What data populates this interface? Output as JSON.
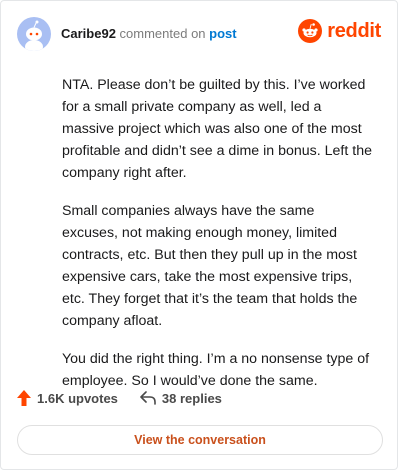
{
  "header": {
    "username": "Caribe92",
    "action_text": "commented on",
    "post_link": "post",
    "brand_name": "reddit"
  },
  "comment": {
    "paragraphs": [
      "NTA. Please don’t be guilted by this. I’ve worked for a small private company as well, led a massive project which was also one of the most profitable and didn’t see a dime in bonus. Left the company right after.",
      "Small companies always have the same excuses, not making enough money, limited contracts, etc. But then they pull up in the most expensive cars, take the most expensive trips, etc. They forget that it’s the team that holds the company afloat.",
      "You did the right thing. I’m a no nonsense type of employee. So I would’ve done the same."
    ]
  },
  "actions": {
    "upvotes": "1.6K upvotes",
    "replies": "38 replies"
  },
  "cta": {
    "label": "View the conversation"
  },
  "icons": {
    "avatar": "snoo-avatar-icon",
    "brand": "reddit-logo-icon",
    "upvote": "upvote-arrow-icon",
    "reply": "reply-arrow-icon"
  },
  "colors": {
    "brand_orange": "#ff4500",
    "link_blue": "#0079d3",
    "cta_text": "#c9501c",
    "avatar_bg": "#a9bff3"
  }
}
